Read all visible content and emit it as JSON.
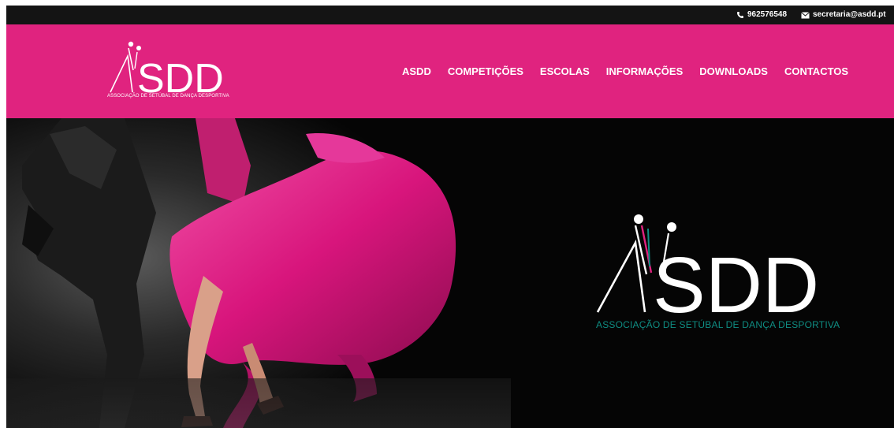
{
  "topbar": {
    "phone": "962576548",
    "email": "secretaria@asdd.pt",
    "phone_icon": "phone-icon",
    "email_icon": "envelope-icon"
  },
  "brand": {
    "logo_text": "SDD",
    "tagline": "ASSOCIAÇÃO DE SETÚBAL DE DANÇA DESPORTIVA"
  },
  "nav": {
    "items": [
      "ASDD",
      "COMPETIÇÕES",
      "ESCOLAS",
      "INFORMAÇÕES",
      "DOWNLOADS",
      "CONTACTOS"
    ]
  },
  "hero": {
    "logo_text": "SDD",
    "tagline": "ASSOCIAÇÃO DE SETÚBAL DE DANÇA DESPORTIVA"
  },
  "colors": {
    "header_pink": "#e0237f",
    "topbar": "#141414",
    "dress_pink": "#e6218a",
    "teal": "#0f8d83"
  }
}
